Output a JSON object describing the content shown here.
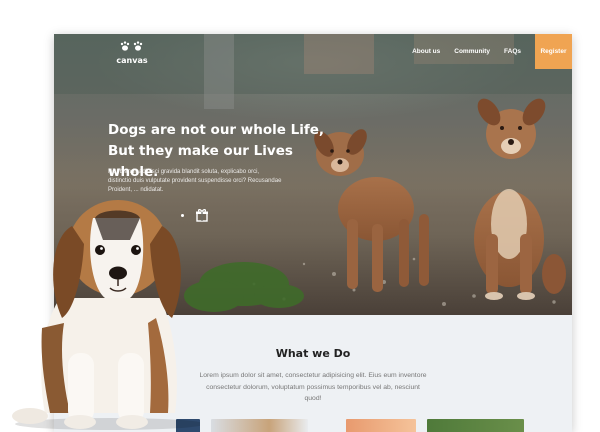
{
  "brand": {
    "name": "canvas",
    "icon": "paw-icon"
  },
  "nav": {
    "about": "About us",
    "community": "Community",
    "faqs": "FAQs",
    "register": "Register"
  },
  "hero": {
    "headline_line1": "Dogs are not our whole Life,",
    "headline_line2": "But they make our Lives whole.",
    "subtext": "Nisl blandit adipisci gravida blandit soluta, explicabo orci, distinctio duis vulputate provident suspendisse orci? Recusandae Proident, ... ndidatat."
  },
  "section": {
    "title": "What we Do",
    "body": "Lorem ipsum dolor sit amet, consectetur adipisicing elit. Eius eum inventore consectetur dolorum, voluptatum possimus temporibus vel ab, nesciunt quod!"
  },
  "colors": {
    "accent": "#f0a452",
    "section_bg": "#eef1f4",
    "heading": "#222222",
    "body_text": "#777777"
  }
}
